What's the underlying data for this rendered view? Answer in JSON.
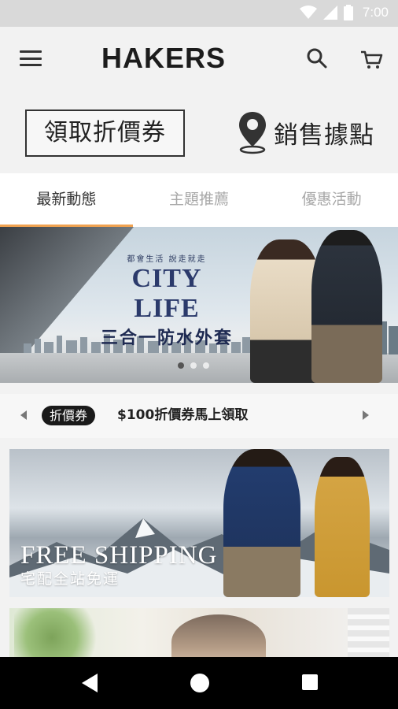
{
  "status_bar": {
    "time": "7:00"
  },
  "app_bar": {
    "brand": "HAKERS",
    "menu_icon": "menu-icon",
    "search_icon": "search-icon",
    "cart_icon": "cart-icon"
  },
  "actions": {
    "coupon_label": "領取折價券",
    "store_label": "銷售據點",
    "store_icon": "location-pin-icon"
  },
  "tabs": [
    {
      "label": "最新動態",
      "active": true
    },
    {
      "label": "主題推薦",
      "active": false
    },
    {
      "label": "優惠活動",
      "active": false
    }
  ],
  "hero": {
    "subtitle": "都會生活 說走就走",
    "title": "CITY LIFE",
    "tagline": "三合一防水外套",
    "slide_count": 3,
    "active_slide": 1
  },
  "marquee": {
    "tag": "折價券",
    "text": "$100折價券馬上領取"
  },
  "promo1": {
    "title": "FREE SHIPPING",
    "subtitle": "宅配全站免運"
  },
  "colors": {
    "accent": "#f0a250",
    "text": "#222222",
    "muted": "#a8a8a8"
  }
}
